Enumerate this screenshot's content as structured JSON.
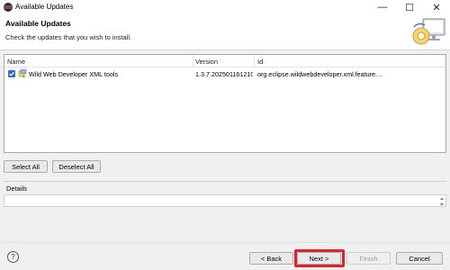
{
  "window": {
    "title": "Available Updates",
    "controls": {
      "minimize": "—",
      "maximize": "☐",
      "close": "✕"
    }
  },
  "banner": {
    "title": "Available Updates",
    "subtitle": "Check the updates that you wish to install."
  },
  "table": {
    "columns": [
      "Name",
      "Version",
      "Id"
    ],
    "rows": [
      {
        "checked": true,
        "name": "Wild Web Developer XML tools",
        "version": "1.3.7.202501161210",
        "id": "org.eclipse.wildwebdeveloper.xml.feature...."
      }
    ]
  },
  "buttons": {
    "select_all": "Select All",
    "deselect_all": "Deselect All",
    "back": "< Back",
    "next": "Next >",
    "finish": "Finish",
    "cancel": "Cancel"
  },
  "details": {
    "label": "Details"
  },
  "help": {
    "label": "?"
  },
  "colors": {
    "highlight": "#e0202a",
    "checkbox": "#2b6cd3"
  }
}
